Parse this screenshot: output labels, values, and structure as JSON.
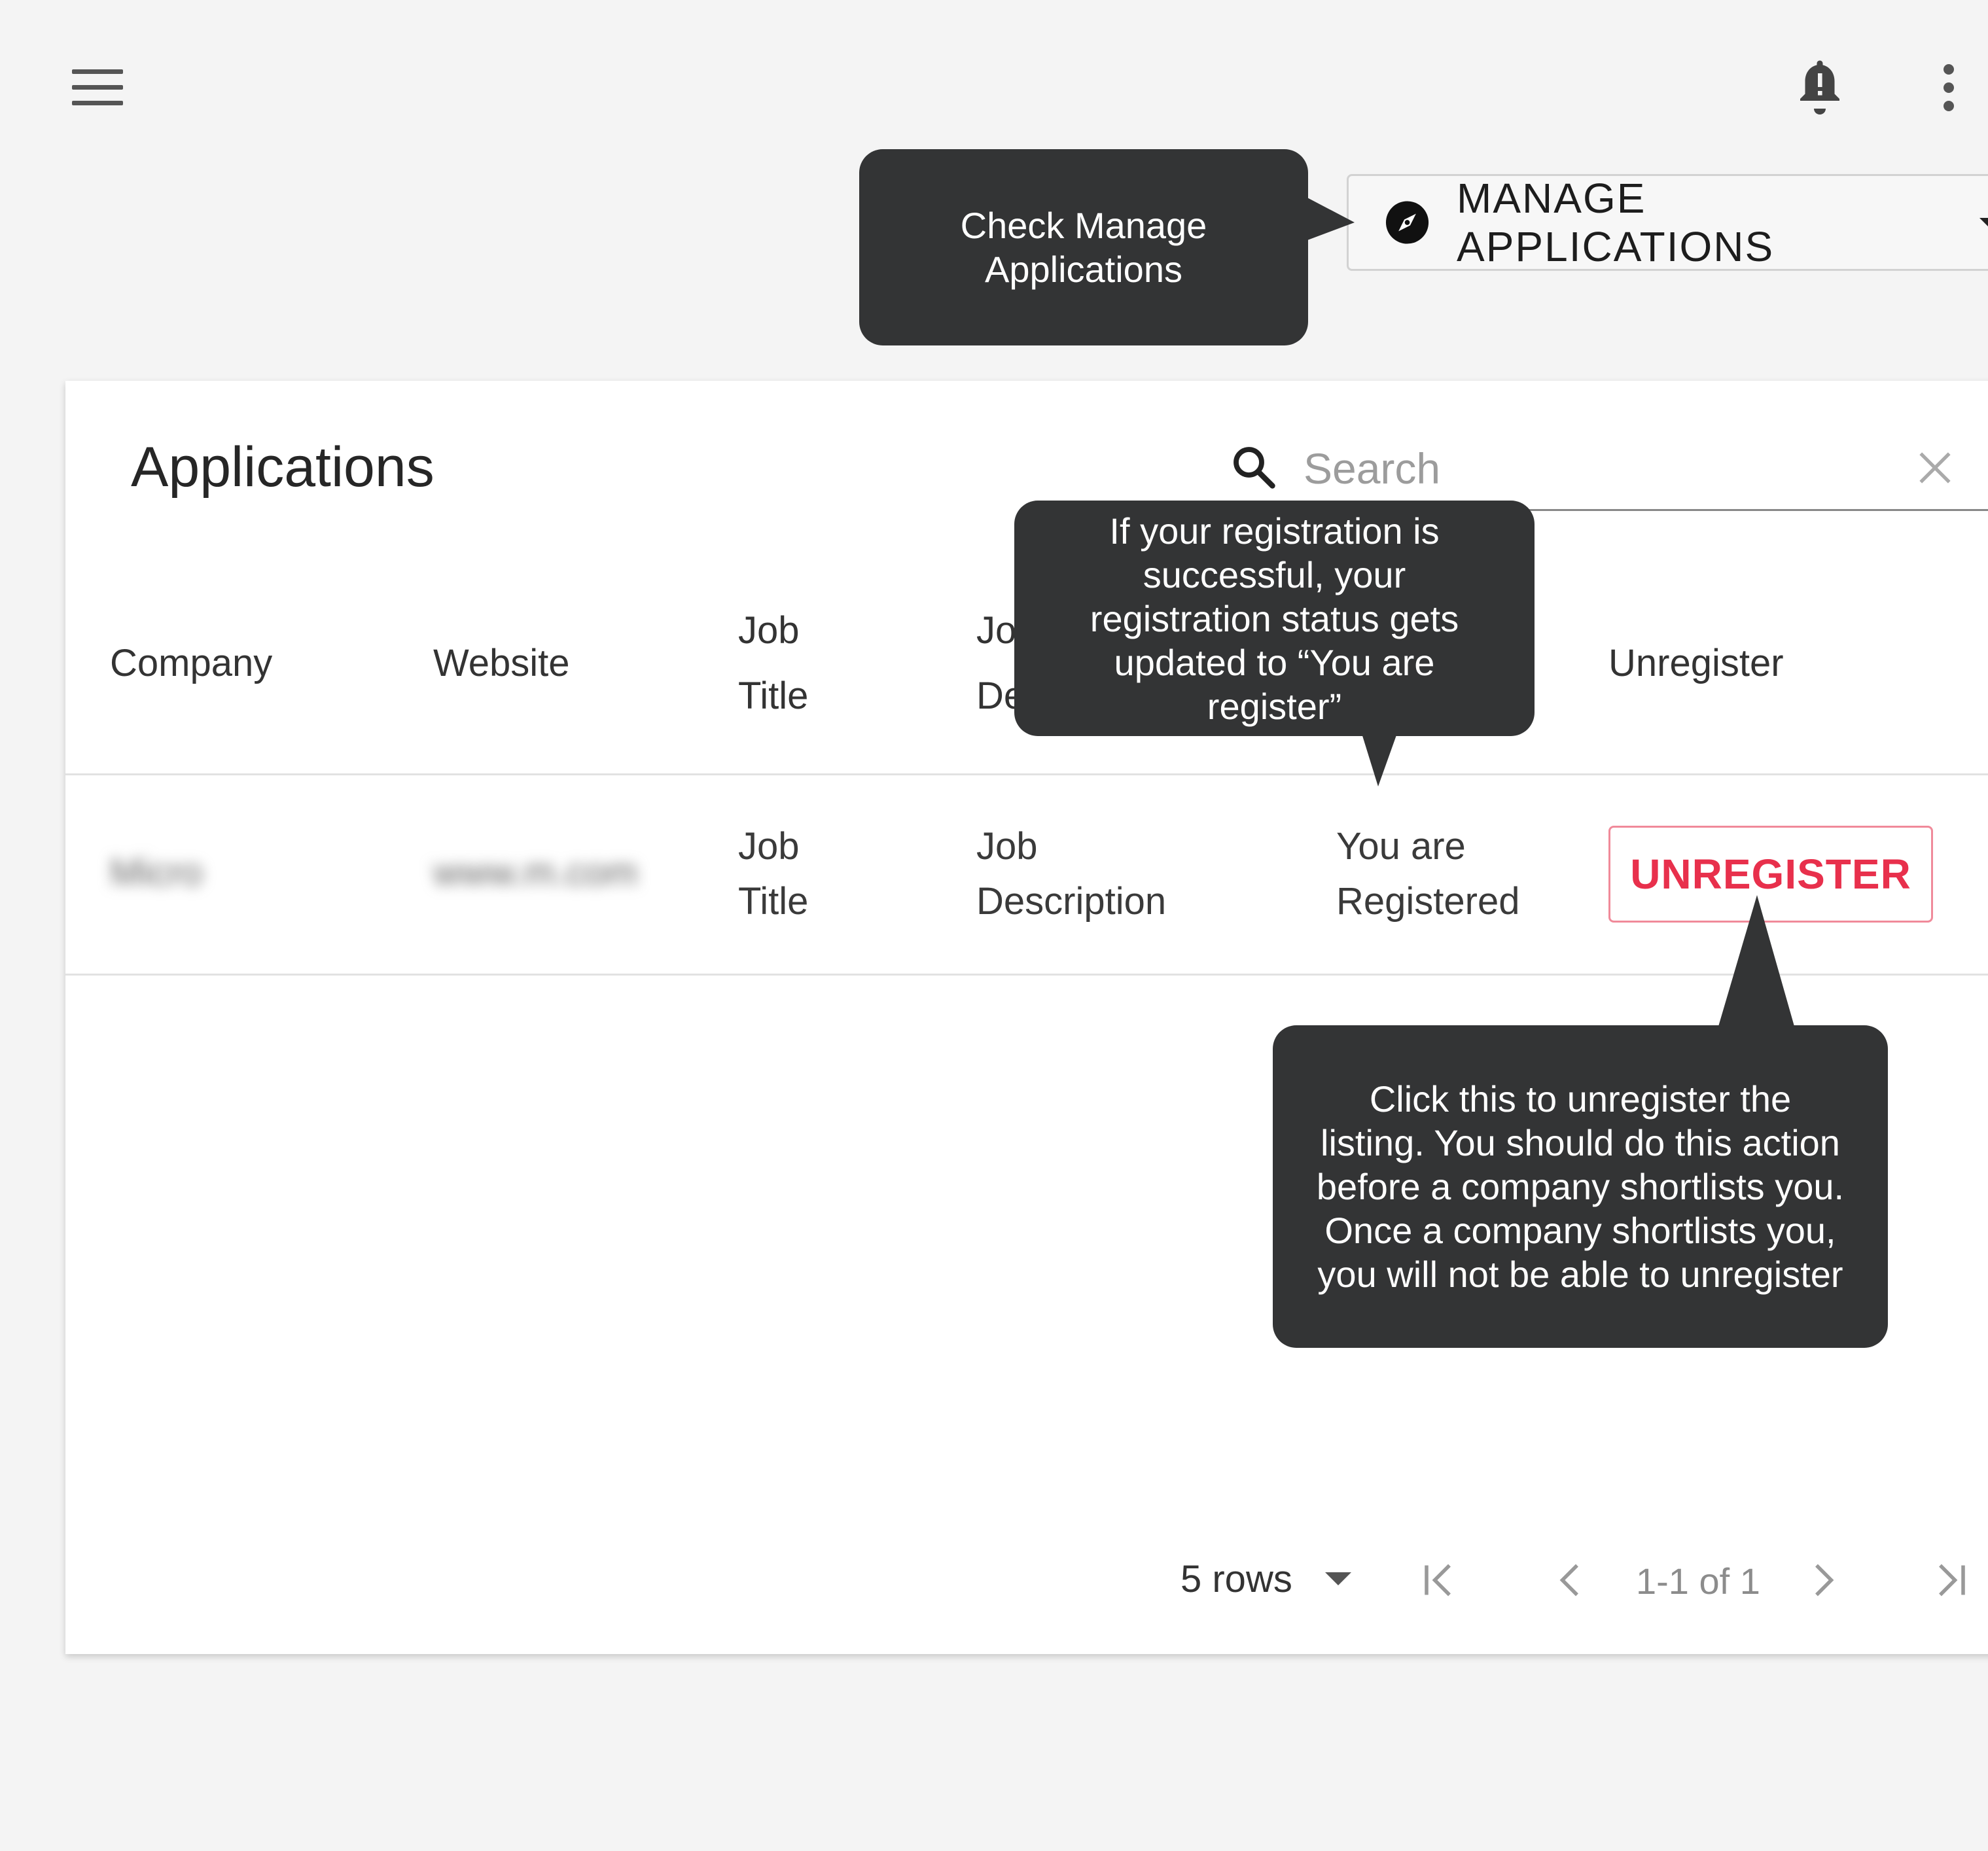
{
  "topbar": {
    "menu_icon": "hamburger-menu-icon",
    "bell_icon": "notification-bell-icon",
    "more_icon": "more-vert-icon"
  },
  "manage_button": {
    "label": "MANAGE APPLICATIONS",
    "icon": "compass-icon",
    "dropdown_icon": "caret-down-icon"
  },
  "callouts": {
    "manage": "Check Manage\nApplications",
    "status": "If your registration is\nsuccessful, your\nregistration status gets\nupdated to “You are\nregister”",
    "unregister": "Click this to unregister the\nlisting. You should do this action\nbefore a company shortlists you.\nOnce a company shortlists you,\nyou will not be able to unregister"
  },
  "card": {
    "title": "Applications",
    "search": {
      "placeholder": "Search",
      "icon": "search-icon",
      "clear_icon": "close-icon"
    }
  },
  "table": {
    "headers": {
      "company": "Company",
      "website": "Website",
      "job_title_1": "Job",
      "job_title_2": "Title",
      "job_desc_1": "Jo",
      "job_desc_2": "De",
      "unregister": "Unregister"
    },
    "row": {
      "company": "Micro",
      "website": "www.m.com",
      "job_title_1": "Job",
      "job_title_2": "Title",
      "job_desc_1": "Job",
      "job_desc_2": "Description",
      "status_1": "You are",
      "status_2": "Registered",
      "unregister_label": "UNREGISTER"
    }
  },
  "pagination": {
    "rows_label": "5 rows",
    "range": "1-1 of 1",
    "icons": [
      "first-page-icon",
      "prev-page-icon",
      "next-page-icon",
      "last-page-icon"
    ]
  },
  "colors": {
    "callout_bg": "#333435",
    "unregister_red": "#e8304c",
    "page_bg": "#f4f4f4"
  }
}
